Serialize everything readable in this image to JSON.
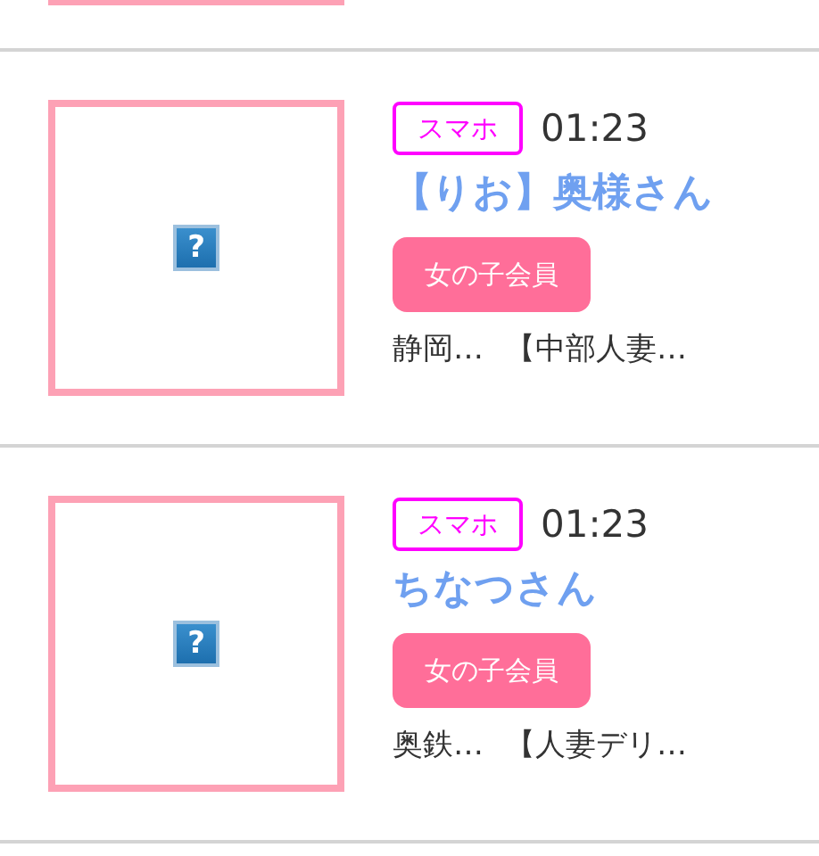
{
  "items": [
    {
      "device": "スマホ",
      "time": "01:23",
      "name": "【りお】奥様さん",
      "tag": "女の子会員",
      "meta": [
        "静岡…",
        "【中部人妻…"
      ],
      "image_icon": "?"
    },
    {
      "device": "スマホ",
      "time": "01:23",
      "name": "ちなつさん",
      "tag": "女の子会員",
      "meta": [
        "奥鉄…",
        "【人妻デリ…"
      ],
      "image_icon": "?"
    }
  ]
}
